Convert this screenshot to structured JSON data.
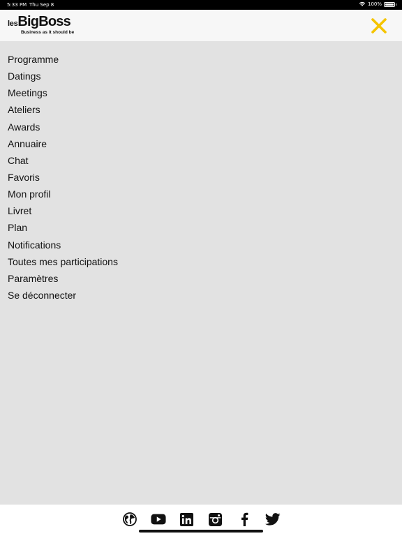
{
  "status_bar": {
    "time": "5:33 PM",
    "date": "Thu Sep 8",
    "battery": "100%",
    "icons": [
      "wifi-icon",
      "battery-icon"
    ]
  },
  "header": {
    "logo_les": "les",
    "logo_bigboss": "BigBoss",
    "logo_tagline": "Business as it should be",
    "close_icon": "close-icon",
    "accent_color": "#f5c400"
  },
  "menu": {
    "items": [
      {
        "label": "Programme"
      },
      {
        "label": "Datings"
      },
      {
        "label": "Meetings"
      },
      {
        "label": "Ateliers"
      },
      {
        "label": "Awards"
      },
      {
        "label": "Annuaire"
      },
      {
        "label": "Chat"
      },
      {
        "label": "Favoris"
      },
      {
        "label": "Mon profil"
      },
      {
        "label": "Livret"
      },
      {
        "label": "Plan"
      },
      {
        "label": "Notifications"
      },
      {
        "label": "Toutes mes participations"
      },
      {
        "label": "Paramètres"
      },
      {
        "label": "Se déconnecter"
      }
    ]
  },
  "footer": {
    "social_icons": [
      "globe-icon",
      "youtube-icon",
      "linkedin-icon",
      "instagram-icon",
      "facebook-icon",
      "twitter-icon"
    ]
  },
  "colors": {
    "background": "#e2e2e2",
    "header_bg": "#f7f7f7",
    "text": "#111111"
  }
}
